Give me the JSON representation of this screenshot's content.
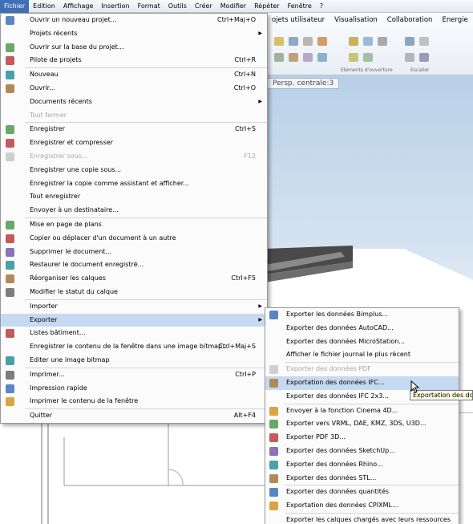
{
  "menubar": [
    "Fichier",
    "Edition",
    "Affichage",
    "Insertion",
    "Format",
    "Outils",
    "Créer",
    "Modifier",
    "Répéter",
    "Fenêtre",
    "?"
  ],
  "ribbon": {
    "tabs": [
      "ojets utilisateur",
      "Visualisation",
      "Collaboration",
      "Energie"
    ],
    "groups": [
      "Eléments d'ouverture",
      "Escalier"
    ]
  },
  "viewport": {
    "tab": "Persp. centrale:3"
  },
  "fichier_menu": [
    {
      "label": "Ouvrir un nouveau projet...",
      "shortcut": "Ctrl+Maj+O",
      "icon": "folder-project-icon"
    },
    {
      "label": "Projets récents",
      "submenu": true
    },
    {
      "label": "Ouvrir sur la base du projet...",
      "icon": "project-base-icon"
    },
    {
      "label": "Pilote de projets",
      "shortcut": "Ctrl+R",
      "icon": "project-pilot-icon"
    },
    {
      "sep": true
    },
    {
      "label": "Nouveau",
      "shortcut": "Ctrl+N",
      "icon": "new-file-icon"
    },
    {
      "label": "Ouvrir...",
      "shortcut": "Ctrl+O",
      "icon": "open-folder-icon"
    },
    {
      "label": "Documents récents",
      "submenu": true
    },
    {
      "label": "Tout fermer",
      "disabled": true
    },
    {
      "sep": true
    },
    {
      "label": "Enregistrer",
      "shortcut": "Ctrl+S",
      "icon": "save-icon"
    },
    {
      "label": "Enregistrer et compresser",
      "icon": "save-compress-icon"
    },
    {
      "label": "Enregistrer sous...",
      "shortcut": "F12",
      "disabled": true,
      "icon": "save-as-icon"
    },
    {
      "label": "Enregistrer une copie sous..."
    },
    {
      "label": "Enregistrer la copie comme assistant et afficher..."
    },
    {
      "label": "Tout enregistrer"
    },
    {
      "label": "Envoyer à un destinataire..."
    },
    {
      "sep": true
    },
    {
      "label": "Mise en page de plans",
      "icon": "page-layout-icon"
    },
    {
      "label": "Copier ou déplacer d'un document à un autre",
      "icon": "copy-move-icon"
    },
    {
      "label": "Supprimer le document...",
      "icon": "delete-document-icon"
    },
    {
      "label": "Restaurer le document enregistré...",
      "icon": "restore-document-icon"
    },
    {
      "label": "Réorganiser les calques",
      "shortcut": "Ctrl+F5",
      "icon": "reorganize-layers-icon"
    },
    {
      "label": "Modifier le statut du calque",
      "icon": "layer-status-icon"
    },
    {
      "sep": true
    },
    {
      "label": "Importer",
      "submenu": true
    },
    {
      "label": "Exporter",
      "submenu": true,
      "highlighted": true
    },
    {
      "label": "Listes bâtiment...",
      "icon": "building-list-icon"
    },
    {
      "label": "Enregistrer le contenu de la fenêtre dans une image bitmap...",
      "shortcut": "Ctrl+Maj+S"
    },
    {
      "label": "Editer une image bitmap",
      "icon": "edit-bitmap-icon"
    },
    {
      "sep": true
    },
    {
      "label": "Imprimer...",
      "shortcut": "Ctrl+P",
      "icon": "printer-icon"
    },
    {
      "label": "Impression rapide",
      "icon": "quick-print-icon"
    },
    {
      "label": "Imprimer le contenu de la fenêtre",
      "icon": "print-window-icon"
    },
    {
      "sep": true
    },
    {
      "label": "Quitter",
      "shortcut": "Alt+F4"
    }
  ],
  "exporter_menu": [
    {
      "label": "Exporter les données Bimplus...",
      "icon": "bimplus-icon"
    },
    {
      "label": "Exporter des données AutoCAD..."
    },
    {
      "label": "Exporter des données MicroStation..."
    },
    {
      "label": "Afficher le fichier journal le plus récent"
    },
    {
      "sep": true
    },
    {
      "label": "Exporter des données PDF",
      "disabled": true,
      "icon": "pdf-icon"
    },
    {
      "label": "Exportation des données IFC...",
      "highlighted": true,
      "icon": "ifc-icon"
    },
    {
      "label": "Exporter des données IFC 2x3..."
    },
    {
      "sep": true
    },
    {
      "label": "Envoyer à la fonction Cinema 4D...",
      "icon": "cinema4d-icon"
    },
    {
      "label": "Exporter vers VRML, DAE, KMZ, 3DS, U3D...",
      "icon": "vrml-icon"
    },
    {
      "label": "Exporter PDF 3D...",
      "icon": "pdf3d-icon"
    },
    {
      "label": "Exporter des données SketchUp...",
      "icon": "sketchup-icon"
    },
    {
      "label": "Exporter des données Rhino...",
      "icon": "rhino-icon"
    },
    {
      "label": "Exporter des données STL...",
      "icon": "stl-icon"
    },
    {
      "sep": true
    },
    {
      "label": "Exporter des données quantités",
      "icon": "quantities-icon"
    },
    {
      "label": "Exportation des données CPIXML...",
      "icon": "cpixml-icon"
    },
    {
      "sep": true
    },
    {
      "label": "Exporter les calques chargés avec leurs ressources"
    }
  ],
  "tooltip": "Exportation des données IFC...",
  "colors": {
    "highlight": "#c6d9f2",
    "menubar_active": "#3f6fb5"
  }
}
